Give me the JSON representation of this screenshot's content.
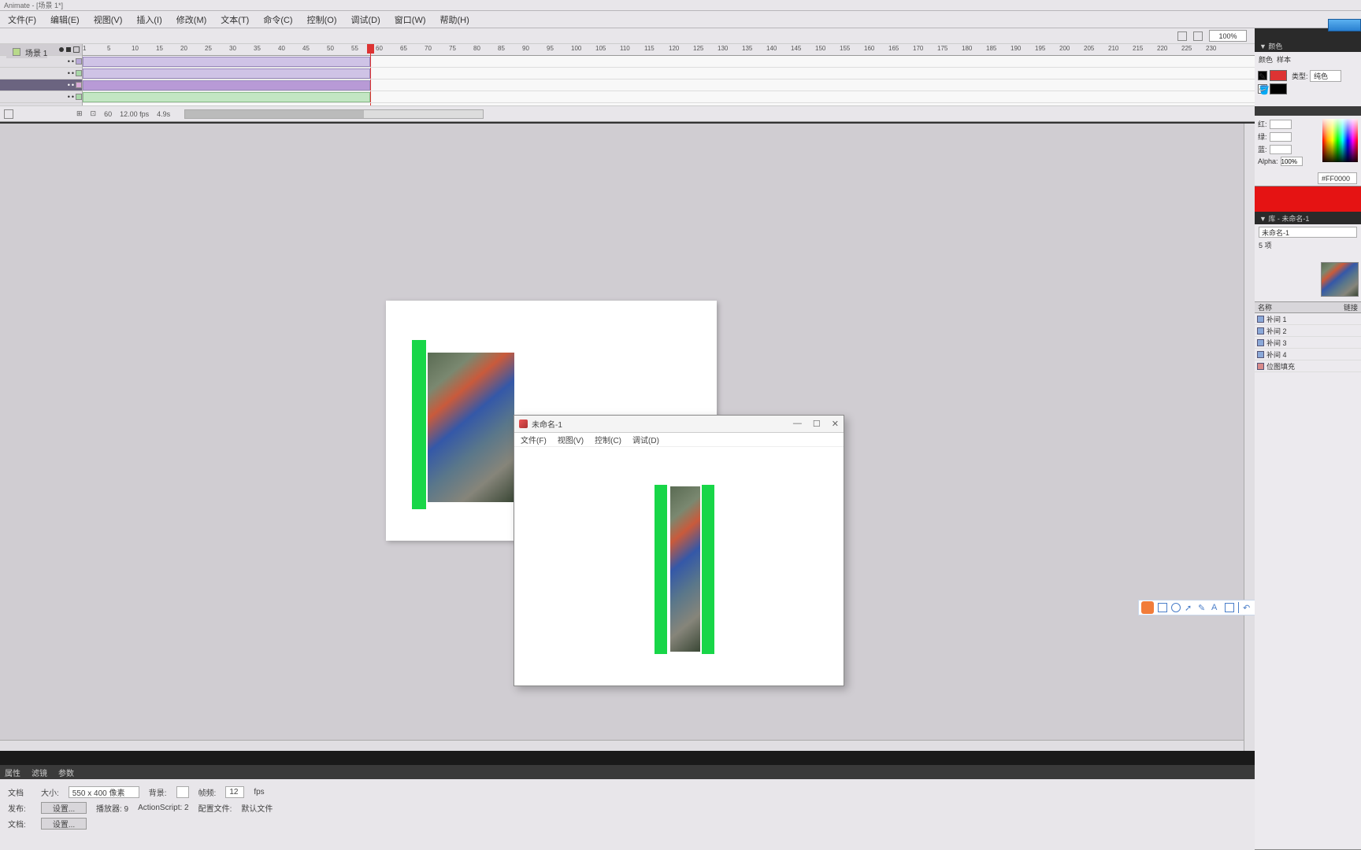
{
  "app": {
    "title": "Animate - [场景 1*]"
  },
  "menu": {
    "items": [
      "文件(F)",
      "编辑(E)",
      "视图(V)",
      "插入(I)",
      "修改(M)",
      "文本(T)",
      "命令(C)",
      "控制(O)",
      "调试(D)",
      "窗口(W)",
      "帮助(H)"
    ]
  },
  "timeline": {
    "doc_name": "场景 1",
    "zoom": "100%",
    "ruler_ticks": [
      "1",
      "5",
      "10",
      "15",
      "20",
      "25",
      "30",
      "35",
      "40",
      "45",
      "50",
      "55",
      "60",
      "65",
      "70",
      "75",
      "80",
      "85",
      "90",
      "95",
      "100",
      "105",
      "110",
      "115",
      "120",
      "125",
      "130",
      "135",
      "140",
      "145",
      "150",
      "155",
      "160",
      "165",
      "170",
      "175",
      "180",
      "185",
      "190",
      "195",
      "200",
      "205",
      "210",
      "215",
      "220",
      "225",
      "230"
    ],
    "playhead_frame": 55,
    "layers": [
      {
        "name": "",
        "color": "#b8a8d8",
        "selected": false
      },
      {
        "name": "",
        "color": "#a8d8a8",
        "selected": false
      },
      {
        "name": "",
        "color": "#d8a8d8",
        "selected": true
      },
      {
        "name": "",
        "color": "#a8d8a8",
        "selected": false
      }
    ],
    "footer": {
      "frame": "60",
      "fps": "12.00 fps",
      "time": "4.9s"
    }
  },
  "preview": {
    "title": "未命名-1",
    "menu": [
      "文件(F)",
      "视图(V)",
      "控制(C)",
      "调试(D)"
    ]
  },
  "right": {
    "panels": {
      "color_title": "颜色",
      "swatch_tab1": "颜色",
      "swatch_tab2": "样本",
      "type_label": "类型:",
      "type_value": "纯色",
      "swatch_header": "▼ 颜色",
      "alpha_label": "Alpha:",
      "alpha_value": "100%",
      "hex_value": "#FF0000"
    },
    "library": {
      "header": "▼ 库 - 未命名-1",
      "doc": "未命名-1",
      "count": "5 项",
      "col_name": "名称",
      "col_link": "链接",
      "items": [
        {
          "name": "补间 1",
          "type": "mc"
        },
        {
          "name": "补间 2",
          "type": "mc"
        },
        {
          "name": "补间 3",
          "type": "mc"
        },
        {
          "name": "补间 4",
          "type": "mc"
        },
        {
          "name": "位图填充",
          "type": "bmp"
        }
      ]
    }
  },
  "props": {
    "tabs": [
      "属性",
      "滤镜",
      "参数"
    ],
    "rows": {
      "r1_label": "文档",
      "r1_size": "大小:",
      "r1_size_val": "550 x 400 像素",
      "r1_bg": "背景:",
      "r1_fps": "帧频:",
      "r1_fps_val": "12",
      "r1_fps_unit": "fps",
      "r2_label": "发布:",
      "r2_pub_btn": "设置...",
      "r2_player": "播放器: 9",
      "r2_as": "ActionScript: 2",
      "r2_profile": "配置文件:",
      "r2_profile_val": "默认文件",
      "r3_label": "文档:",
      "r3_btn": "设置..."
    }
  }
}
